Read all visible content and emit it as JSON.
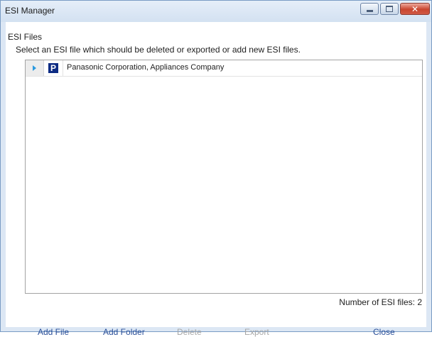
{
  "window": {
    "title": "ESI Manager",
    "controls": [
      "minimize-icon",
      "maximize-icon",
      "close-icon"
    ]
  },
  "section": {
    "label": "ESI Files",
    "instruction": "Select an ESI file which should be deleted or exported or add new ESI files."
  },
  "files": [
    {
      "logo_letter": "P",
      "name": "Panasonic Corporation, Appliances Company"
    }
  ],
  "status": {
    "count_text": "Number of ESI files: 2"
  },
  "buttons": {
    "add_file": "Add File",
    "add_folder": "Add Folder",
    "delete": "Delete",
    "export": "Export",
    "close": "Close"
  },
  "colors": {
    "accent_link": "#2a4f99",
    "disabled": "#a6a6a6",
    "expander_arrow": "#2a9ae0",
    "logo_bg": "#0d2b83"
  }
}
